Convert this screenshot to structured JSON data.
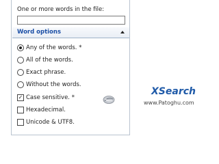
{
  "file_section": {
    "label": "One or more words in the file:",
    "input_value": "",
    "input_placeholder": ""
  },
  "word_options": {
    "title": "Word options",
    "radios": [
      {
        "label": "Any of the words. *",
        "checked": true
      },
      {
        "label": "All of the words.",
        "checked": false
      },
      {
        "label": "Exact phrase.",
        "checked": false
      },
      {
        "label": "Without the words.",
        "checked": false
      }
    ],
    "checkboxes": [
      {
        "label": "Case sensitive. *",
        "checked": true
      },
      {
        "label": "Hexadecimal.",
        "checked": false
      },
      {
        "label": "Unicode & UTF8.",
        "checked": false
      }
    ]
  },
  "watermark": {
    "brand": "XSearch",
    "site": "www.Patoghu.com"
  },
  "colors": {
    "accent": "#1b4fa6",
    "brand": "#1f5aa8",
    "panel_border": "#b9c3cf"
  },
  "icons": {
    "collapse": "chevron-up-icon",
    "logo": "patoghu-logo-icon"
  }
}
